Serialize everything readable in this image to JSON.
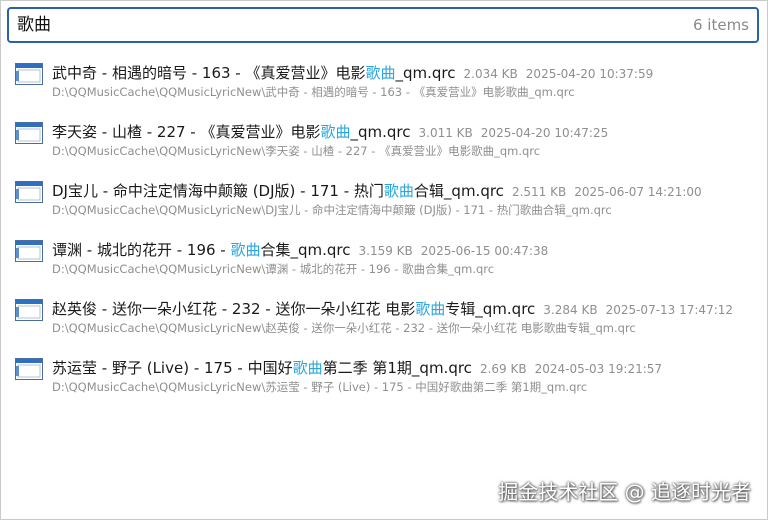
{
  "search": {
    "value": "歌曲",
    "count": "6 items"
  },
  "results": [
    {
      "name_pre": "武中奇 - 相遇的暗号 - 163 - 《真爱营业》电影",
      "name_hl": "歌曲",
      "name_post": "_qm.qrc",
      "size": "2.034 KB",
      "date": "2025-04-20 10:37:59",
      "path": "D:\\QQMusicCache\\QQMusicLyricNew\\武中奇 - 相遇的暗号 - 163 - 《真爱营业》电影歌曲_qm.qrc"
    },
    {
      "name_pre": "李天姿 - 山楂 - 227 - 《真爱营业》电影",
      "name_hl": "歌曲",
      "name_post": "_qm.qrc",
      "size": "3.011 KB",
      "date": "2025-04-20 10:47:25",
      "path": "D:\\QQMusicCache\\QQMusicLyricNew\\李天姿 - 山楂 - 227 - 《真爱营业》电影歌曲_qm.qrc"
    },
    {
      "name_pre": "DJ宝儿 - 命中注定情海中颠簸 (DJ版) - 171 - 热门",
      "name_hl": "歌曲",
      "name_post": "合辑_qm.qrc",
      "size": "2.511 KB",
      "date": "2025-06-07 14:21:00",
      "path": "D:\\QQMusicCache\\QQMusicLyricNew\\DJ宝儿 - 命中注定情海中颠簸 (DJ版) - 171 - 热门歌曲合辑_qm.qrc"
    },
    {
      "name_pre": "谭渊 - 城北的花开 - 196 - ",
      "name_hl": "歌曲",
      "name_post": "合集_qm.qrc",
      "size": "3.159 KB",
      "date": "2025-06-15 00:47:38",
      "path": "D:\\QQMusicCache\\QQMusicLyricNew\\谭渊 - 城北的花开 - 196 - 歌曲合集_qm.qrc"
    },
    {
      "name_pre": "赵英俊 - 送你一朵小红花 - 232 - 送你一朵小红花 电影",
      "name_hl": "歌曲",
      "name_post": "专辑_qm.qrc",
      "size": "3.284 KB",
      "date": "2025-07-13 17:47:12",
      "path": "D:\\QQMusicCache\\QQMusicLyricNew\\赵英俊 - 送你一朵小红花 - 232 - 送你一朵小红花 电影歌曲专辑_qm.qrc"
    },
    {
      "name_pre": "苏运莹 - 野子 (Live) - 175 - 中国好",
      "name_hl": "歌曲",
      "name_post": "第二季 第1期_qm.qrc",
      "size": "2.69 KB",
      "date": "2024-05-03 19:21:57",
      "path": "D:\\QQMusicCache\\QQMusicLyricNew\\苏运莹 - 野子 (Live) - 175 - 中国好歌曲第二季 第1期_qm.qrc"
    }
  ],
  "watermark": "掘金技术社区 @ 追逐时光者",
  "colors": {
    "accent": "#2a62a8",
    "highlight": "#2aa6de",
    "meta_text": "#8f8f8f"
  },
  "icons": {
    "file": "document-window-icon"
  }
}
